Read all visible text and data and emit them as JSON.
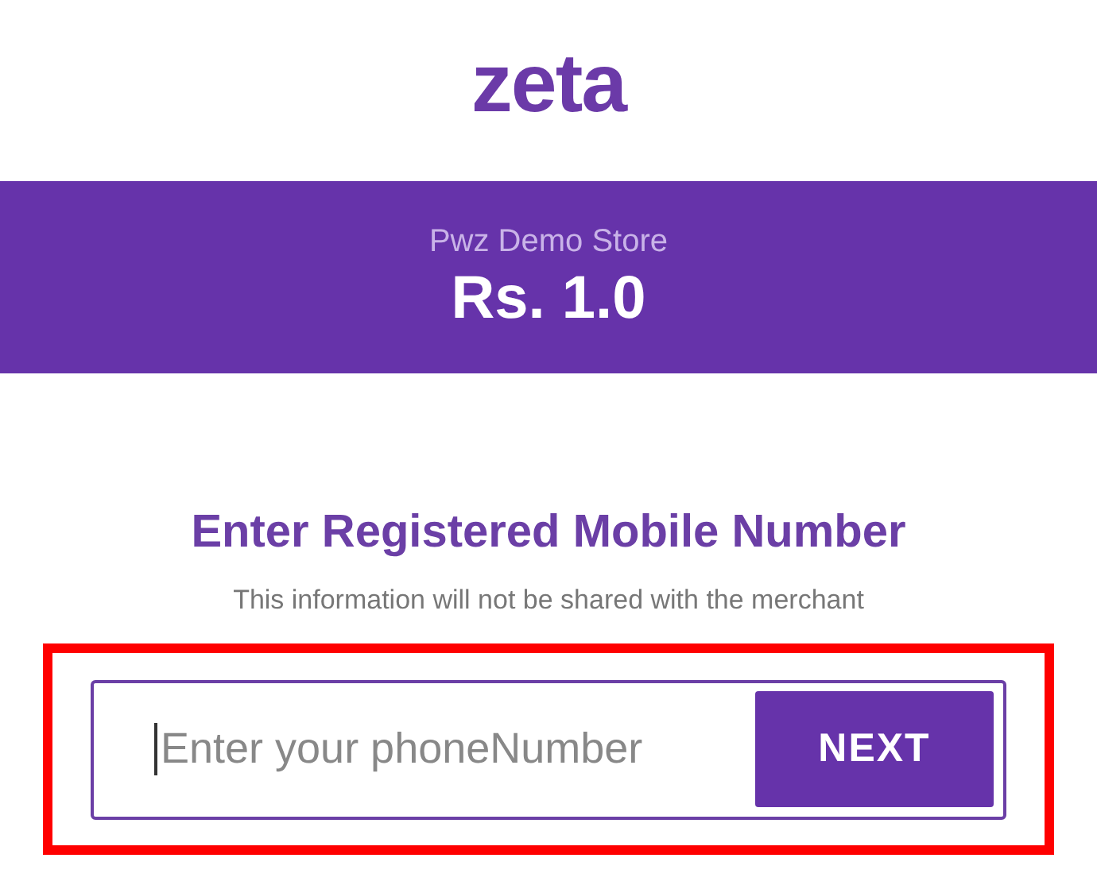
{
  "logo": "zeta",
  "banner": {
    "store": "Pwz Demo Store",
    "amount": "Rs. 1.0"
  },
  "heading": "Enter Registered Mobile Number",
  "note": "This information will not be shared with the merchant",
  "highlight": {
    "on": true
  },
  "phone_field": {
    "placeholder": "Enter your phoneNumber",
    "focused": true
  },
  "button": "NEXT"
}
